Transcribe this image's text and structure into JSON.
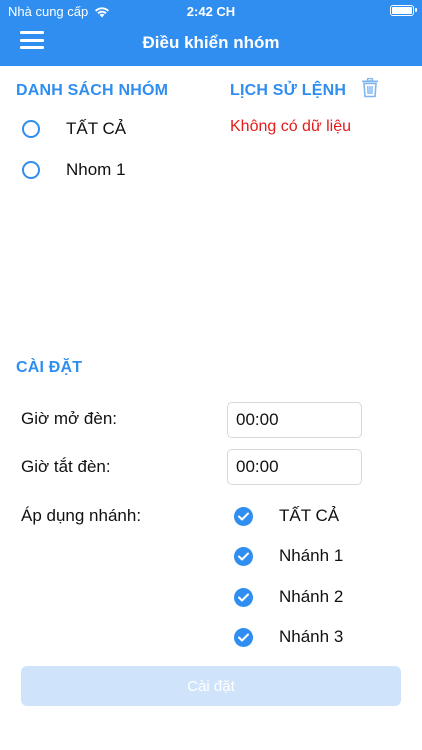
{
  "status_bar": {
    "carrier": "Nhà cung cấp",
    "time": "2:42 CH"
  },
  "header": {
    "title": "Điều khiển nhóm"
  },
  "groups": {
    "title": "DANH SÁCH NHÓM",
    "items": [
      {
        "label": "TẤT CẢ",
        "selected": false
      },
      {
        "label": "Nhom 1",
        "selected": false
      }
    ]
  },
  "history": {
    "title": "LỊCH SỬ LỆNH",
    "empty_text": "Không có dữ liệu"
  },
  "settings": {
    "title": "CÀI ĐẶT",
    "on_time_label": "Giờ mở đèn:",
    "on_time_value": "00:00",
    "off_time_label": "Giờ tắt đèn:",
    "off_time_value": "00:00",
    "branches_label": "Áp dụng nhánh:",
    "branches": [
      {
        "label": "TẤT CẢ",
        "checked": true
      },
      {
        "label": "Nhánh 1",
        "checked": true
      },
      {
        "label": "Nhánh 2",
        "checked": true
      },
      {
        "label": "Nhánh 3",
        "checked": true
      }
    ],
    "submit_label": "Cài đặt"
  },
  "colors": {
    "accent": "#2f8ef0",
    "error": "#e41b1b",
    "disabled_button": "#cfe4fb"
  }
}
